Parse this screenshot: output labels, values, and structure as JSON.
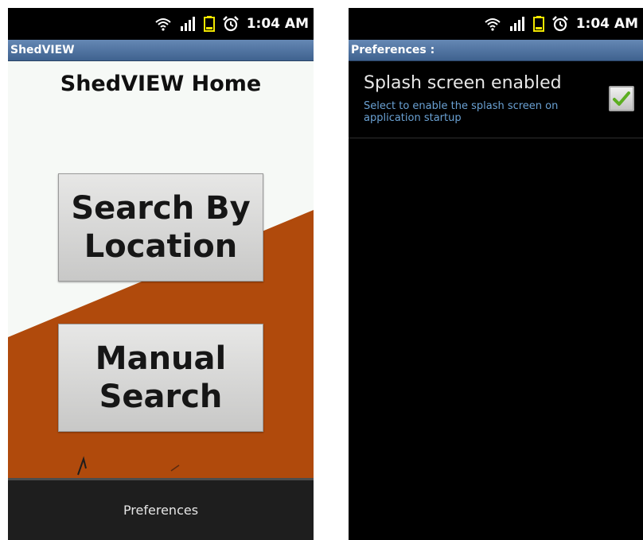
{
  "screens": [
    {
      "status": {
        "time": "1:04 AM",
        "icons": [
          "wifi-icon",
          "signal-icon",
          "battery-icon",
          "alarm-icon"
        ]
      },
      "app_bar_title": "ShedVIEW",
      "home_title": "ShedVIEW Home",
      "buttons": [
        "Search By Location",
        "Manual Search"
      ],
      "menu_item": "Preferences",
      "colors": {
        "accent_orange": "#b04a0c",
        "title_bar": "#4a6d99"
      }
    },
    {
      "status": {
        "time": "1:04 AM",
        "icons": [
          "wifi-icon",
          "signal-icon",
          "battery-icon",
          "alarm-icon"
        ]
      },
      "app_bar_title": "Preferences :",
      "preference": {
        "title": "Splash screen enabled",
        "summary": "Select to enable the splash screen on application startup",
        "checked": true
      },
      "colors": {
        "summary_text": "#6aa1d3",
        "check_green": "#5cae22"
      }
    }
  ]
}
